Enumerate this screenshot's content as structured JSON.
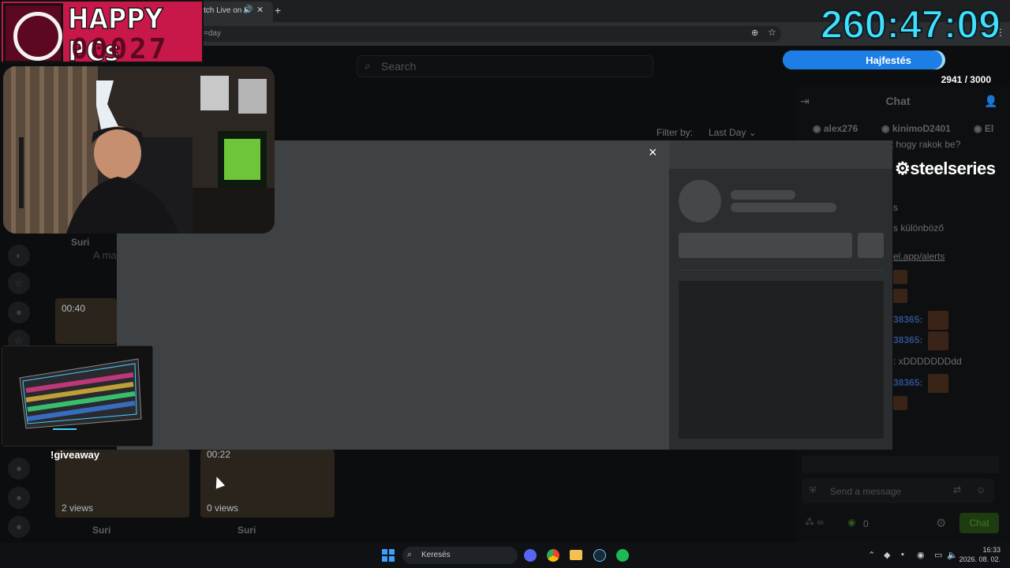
{
  "browser": {
    "tab_title": "tch Live on K",
    "tab_audio_icon": "speaker-icon",
    "url_fragment": "=day"
  },
  "page": {
    "search_placeholder": "Search",
    "filter_label": "Filter by:",
    "filter_value": "Last Day"
  },
  "clips": [
    {
      "duration": "00:40",
      "views": "",
      "author": "Suri",
      "title": "A ma"
    },
    {
      "duration": "",
      "views": "2 views",
      "author": "Suri"
    },
    {
      "duration": "00:22",
      "views": "0 views",
      "author": "Suri"
    }
  ],
  "chat": {
    "title": "Chat",
    "gifters": [
      "alex276",
      "kinimoD2401",
      "El"
    ],
    "messages": [
      {
        "text": "ot hogy rakok be?"
      },
      {
        "text": "s"
      },
      {
        "text": "s különböző"
      },
      {
        "text": "el.app/alerts"
      },
      {
        "mention": "38365:"
      },
      {
        "mention": "38365:"
      },
      {
        "text": ": xDDDDDDDdd"
      },
      {
        "mention": "38365:"
      }
    ],
    "message_placeholder": "Send a message",
    "points": "0",
    "send_label": "Chat"
  },
  "modal": {
    "close_label": "×"
  },
  "overlay": {
    "logo_title": "HAPPY PCs",
    "logo_count": "00027",
    "timer": "260:47:09",
    "goal_label": "Hajfestés",
    "goal_progress": "2941 / 3000",
    "goal_fraction": 0.98,
    "sponsor": "steelseries",
    "giveaway": "!giveaway"
  },
  "taskbar": {
    "search_label": "Keresés",
    "time": "16:33",
    "date": "2026. 08. 02."
  },
  "colors": {
    "timer": "#40e0ff",
    "goal_fill": "#1d7fe6",
    "brand": "#c8184a"
  }
}
